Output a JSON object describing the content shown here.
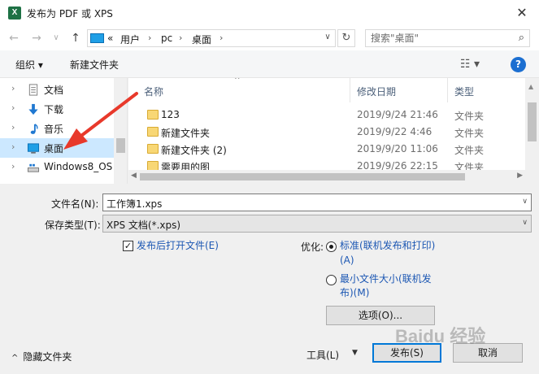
{
  "window": {
    "title": "发布为 PDF 或 XPS",
    "app_icon_letter": "X",
    "close_glyph": "✕"
  },
  "address": {
    "back_glyph": "←",
    "forward_glyph": "→",
    "up_glyph": "↑",
    "breadcrumb_prefix": "«",
    "segments": [
      "用户",
      "pc",
      "桌面"
    ],
    "separator": "›",
    "dropdown_glyph": "∨",
    "refresh_glyph": "↻",
    "search_placeholder": "搜索\"桌面\"",
    "search_glyph": "⌕"
  },
  "toolbar": {
    "organize_label": "组织 ▾",
    "new_folder_label": "新建文件夹",
    "view_glyph": "☷ ▾",
    "help_glyph": "?"
  },
  "nav": {
    "items": [
      {
        "label": "文档",
        "icon": "document-icon"
      },
      {
        "label": "下载",
        "icon": "download-icon"
      },
      {
        "label": "音乐",
        "icon": "music-icon"
      },
      {
        "label": "桌面",
        "icon": "desktop-icon"
      },
      {
        "label": "Windows8_OS",
        "icon": "drive-icon"
      }
    ],
    "chevron": "›"
  },
  "files": {
    "columns": {
      "name": "名称",
      "date": "修改日期",
      "type": "类型"
    },
    "sort_indicator": "^",
    "rows": [
      {
        "name": "123",
        "date": "2019/9/24 21:46",
        "type": "文件夹"
      },
      {
        "name": "新建文件夹",
        "date": "2019/9/22 4:46",
        "type": "文件夹"
      },
      {
        "name": "新建文件夹 (2)",
        "date": "2019/9/20 11:06",
        "type": "文件夹"
      },
      {
        "name": "需要用的图",
        "date": "2019/9/26 22:15",
        "type": "文件夹"
      }
    ]
  },
  "form": {
    "filename_label": "文件名(N):",
    "filename_value": "工作簿1.xps",
    "filetype_label": "保存类型(T):",
    "filetype_value": "XPS 文档(*.xps)",
    "open_after_publish_label": "发布后打开文件(E)",
    "open_after_publish_checked": "✓",
    "optimize_label": "优化:",
    "opt_standard_line1": "标准(联机发布和打印)",
    "opt_standard_line2": "(A)",
    "opt_min_line1": "最小文件大小(联机发",
    "opt_min_line2": "布)(M)",
    "options_button": "选项(O)...",
    "hide_folders_label": "隐藏文件夹",
    "hide_folders_chevron": "^",
    "tools_label": "工具(L)",
    "tools_dd": "▼",
    "publish_button": "发布(S)",
    "cancel_button": "取消"
  },
  "colors": {
    "accent": "#0078d7",
    "selected_bg": "#cce8ff",
    "link_blue": "#1c57b3",
    "annotation_red": "#e8392b"
  },
  "watermark": "Baidu 经验"
}
